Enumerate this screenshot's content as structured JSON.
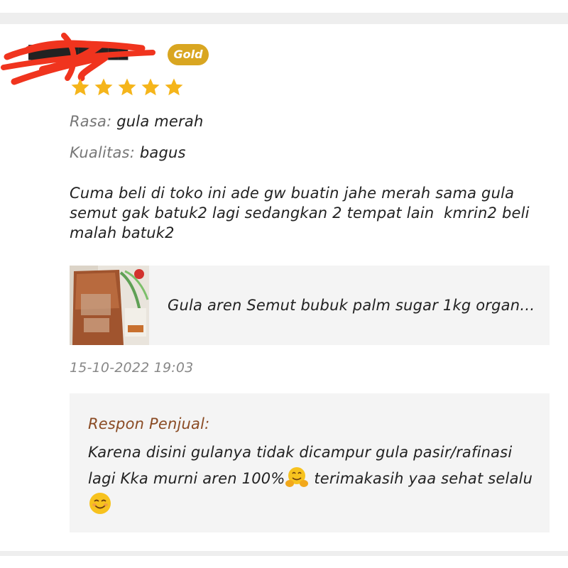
{
  "review": {
    "reviewer_name": "██████████",
    "badge": "Gold",
    "rating": 5,
    "rating_max": 5,
    "attributes": [
      {
        "key": "Rasa:",
        "value": "gula merah"
      },
      {
        "key": "Kualitas:",
        "value": "bagus"
      }
    ],
    "text": "Cuma beli di toko ini ade gw buatin jahe merah sama gula\nsemut gak batuk2 lagi sedangkan 2 tempat lain  kmrin2 beli\nmalah batuk2",
    "product": {
      "title": "Gula aren Semut bubuk palm sugar 1kg organi...",
      "thumbnail_icon": "product-thumbnail"
    },
    "date": "15-10-2022 19:03"
  },
  "seller_response": {
    "label": "Respon Penjual:",
    "line1": "Karena disini gulanya tidak dicampur gula pasir/rafinasi",
    "line2_a": "lagi Kka murni aren 100%",
    "emoji_1": "hugging-face-emoji",
    "line2_b": " terimakasih yaa sehat selalu",
    "emoji_2": "smiling-face-emoji"
  },
  "colors": {
    "badge_gold": "#d9a621",
    "star": "#f5b51b",
    "seller_label": "#8a4b24",
    "redaction": "#f0341e",
    "card_bg": "#f4f4f4"
  }
}
